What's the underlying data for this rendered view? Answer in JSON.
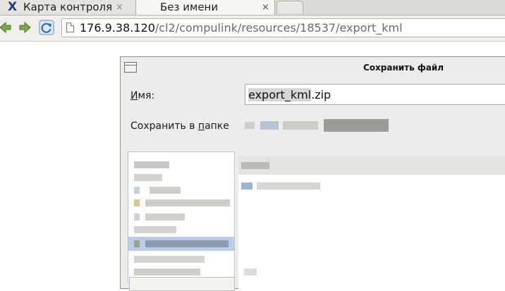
{
  "browser": {
    "tabs": [
      {
        "title": "Карта контроля",
        "close": "×",
        "active": false
      },
      {
        "title": "Без имени",
        "close": "×",
        "active": true
      }
    ],
    "address": {
      "host": "176.9.38.120",
      "path": "/cl2/compulink/resources/18537/export_kml"
    }
  },
  "dialog": {
    "title": "Сохранить файл",
    "name_label": "Имя:",
    "file_name_base": "export_kml",
    "file_name_ext": ".zip",
    "folder_label": "Сохранить в папке"
  },
  "colors": {
    "selection": "#b9cde9",
    "favicon": "#1b3e8c",
    "nav_arrow": "#6e9a3f",
    "reload": "#2f6fb0"
  }
}
